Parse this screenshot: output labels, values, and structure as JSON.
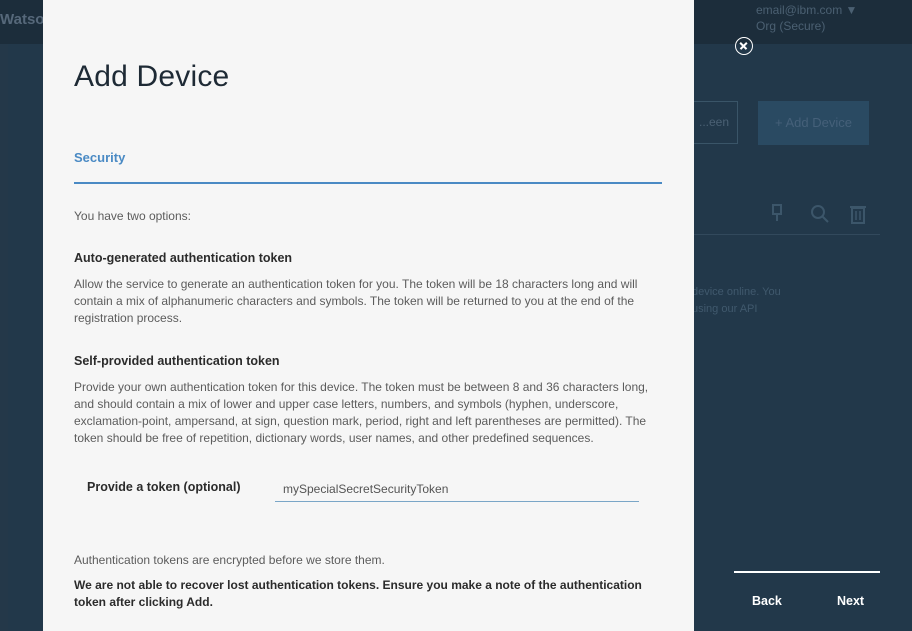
{
  "background": {
    "brand": "Watso",
    "user_email": "email@ibm.com ▼",
    "user_org": "Org (Secure)",
    "secondary_button": "...een",
    "add_device_button": "+ Add Device",
    "text_line1": "device online. You",
    "text_line2": "using our API"
  },
  "modal": {
    "title": "Add Device",
    "section_tab": "Security",
    "intro": "You have two options:",
    "auto": {
      "heading": "Auto-generated authentication token",
      "text": "Allow the service to generate an authentication token for you. The token will be 18 characters long and will contain a mix of alphanumeric characters and symbols. The token will be returned to you at the end of the registration process."
    },
    "self": {
      "heading": "Self-provided authentication token",
      "text": "Provide your own authentication token for this device. The token must be between 8 and 36 characters long, and should contain a mix of lower and upper case letters, numbers, and symbols (hyphen, underscore, exclamation-point, ampersand, at sign, question mark, period, right and left parentheses are permitted). The token should be free of repetition, dictionary words, user names, and other predefined sequences."
    },
    "token_field": {
      "label": "Provide a token (optional)",
      "value": "mySpecialSecretSecurityToken"
    },
    "encrypted_note": "Authentication tokens are encrypted before we store them.",
    "warning": "We are not able to recover lost authentication tokens. Ensure you make a note of the authentication token after clicking Add."
  },
  "nav": {
    "back_label": "Back",
    "next_label": "Next"
  },
  "icons": {
    "close": "close-icon",
    "pin": "pin-icon",
    "search": "search-icon",
    "trash": "trash-icon"
  },
  "colors": {
    "accent": "#4a8ac4",
    "overlay": "#243849",
    "modal_bg": "#f6f6f6"
  }
}
